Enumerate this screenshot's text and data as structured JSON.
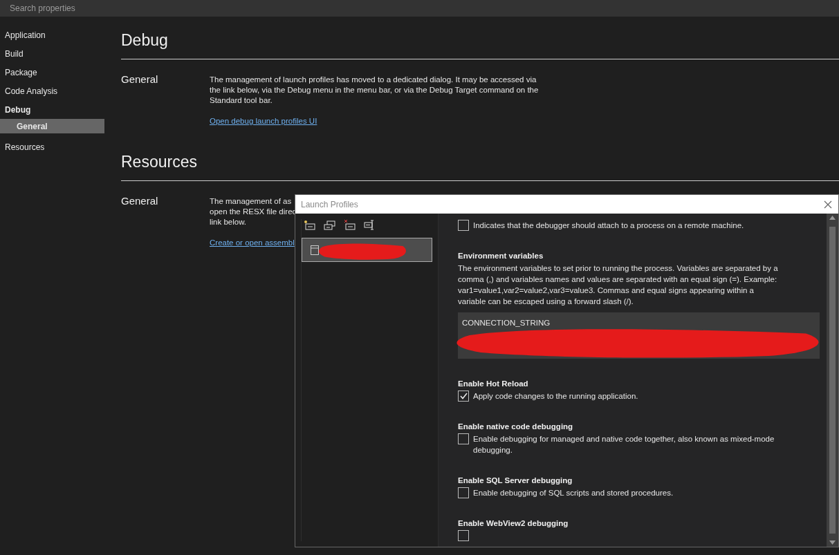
{
  "search": {
    "placeholder": "Search properties"
  },
  "sidebar": {
    "items": [
      {
        "label": "Application",
        "expanded": false,
        "selected": false
      },
      {
        "label": "Build",
        "expanded": false,
        "selected": false
      },
      {
        "label": "Package",
        "expanded": false,
        "selected": false
      },
      {
        "label": "Code Analysis",
        "expanded": false,
        "selected": false
      },
      {
        "label": "Debug",
        "expanded": true,
        "selected": false,
        "children": [
          {
            "label": "General",
            "selected": true
          }
        ]
      },
      {
        "label": "Resources",
        "expanded": false,
        "selected": false
      }
    ]
  },
  "sections": [
    {
      "title": "Debug",
      "groups": [
        {
          "label": "General",
          "description": "The management of launch profiles has moved to a dedicated dialog. It may be accessed via the link below, via the Debug menu in the menu bar, or via the Debug Target command on the Standard tool bar.",
          "link": "Open debug launch profiles UI"
        }
      ]
    },
    {
      "title": "Resources",
      "groups": [
        {
          "label": "General",
          "lines": [
            "The management of as",
            "open the RESX file direc",
            "link below."
          ],
          "link": "Create or open assembl"
        }
      ]
    }
  ],
  "dialog": {
    "title": "Launch Profiles",
    "profiles": [
      {
        "selected": true,
        "redacted": true
      }
    ],
    "settings": [
      {
        "kind": "checkbox",
        "label": "Indicates that the debugger should attach to a process on a remote machine.",
        "checked": false
      },
      {
        "kind": "textarea",
        "title": "Environment variables",
        "description": "The environment variables to set prior to running the process. Variables are separated by a comma (,) and variables names and values are separated with an equal sign (=). Example: var1=value1,var2=value2,var3=value3. Commas and equal signs appearing within a variable can be escaped using a forward slash (/).",
        "value": "CONNECTION_STRING",
        "redacted": true
      },
      {
        "kind": "checkbox",
        "title": "Enable Hot Reload",
        "label": "Apply code changes to the running application.",
        "checked": true
      },
      {
        "kind": "checkbox",
        "title": "Enable native code debugging",
        "label": "Enable debugging for managed and native code together, also known as mixed-mode debugging.",
        "checked": false
      },
      {
        "kind": "checkbox",
        "title": "Enable SQL Server debugging",
        "label": "Enable debugging of SQL scripts and stored procedures.",
        "checked": false
      },
      {
        "kind": "checkbox",
        "title": "Enable WebView2 debugging",
        "checked": false
      }
    ]
  }
}
